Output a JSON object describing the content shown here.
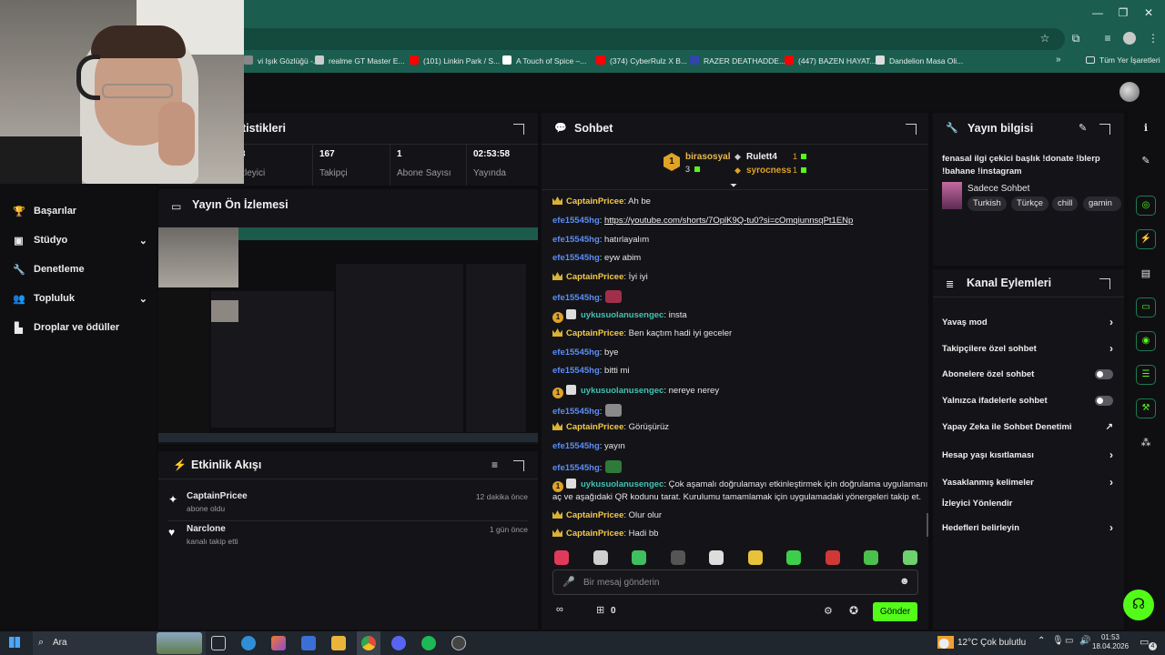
{
  "bookmarks": [
    {
      "label": "vi Işık Gözlüğü -...",
      "color": "#888888"
    },
    {
      "label": "realme GT Master E...",
      "color": "#cccccc"
    },
    {
      "label": "(101) Linkin Park / S...",
      "color": "#ff0000"
    },
    {
      "label": "A Touch of Spice –...",
      "color": "#ffffff"
    },
    {
      "label": "(374) CyberRulz X B...",
      "color": "#ff0000"
    },
    {
      "label": "RAZER DEATHADDE...",
      "color": "#3344aa"
    },
    {
      "label": "(447) BAZEN HAYAT...",
      "color": "#ff0000"
    },
    {
      "label": "Dandelion Masa Oli...",
      "color": "#dddddd"
    }
  ],
  "bookmarks_all": "Tüm Yer İşaretleri",
  "nav": {
    "items": [
      {
        "label": "Başarılar",
        "icon": "trophy-icon",
        "glyph": "🏆",
        "chevron": false
      },
      {
        "label": "Stüdyo",
        "icon": "studio-icon",
        "glyph": "▣",
        "chevron": true
      },
      {
        "label": "Denetleme",
        "icon": "wrench-icon",
        "glyph": "🔧",
        "chevron": false
      },
      {
        "label": "Topluluk",
        "icon": "community-icon",
        "glyph": "👥",
        "chevron": true
      },
      {
        "label": "Droplar ve ödüller",
        "icon": "drops-icon",
        "glyph": "▙",
        "chevron": false
      }
    ]
  },
  "stats": {
    "title": "tistikleri",
    "items": [
      {
        "value": "3",
        "label": "zleyici"
      },
      {
        "value": "167",
        "label": "Takipçi"
      },
      {
        "value": "1",
        "label": "Abone Sayısı"
      },
      {
        "value": "02:53:58",
        "label": "Yayında"
      }
    ]
  },
  "preview": {
    "title": "Yayın Ön İzlemesi"
  },
  "activity": {
    "title": "Etkinlik Akışı",
    "events": [
      {
        "user": "CaptainPricee",
        "action": "abone oldu",
        "time": "12 dakika önce",
        "icon": "sparkle-icon",
        "glyph": "✦"
      },
      {
        "user": "Narclone",
        "action": "kanalı takip etti",
        "time": "1 gün önce",
        "icon": "heart-icon",
        "glyph": "♥"
      }
    ]
  },
  "chat": {
    "title": "Sohbet",
    "top": {
      "rank_badge": "1",
      "user1": "birasosyal",
      "user1_count": "3",
      "user2": "Rulett4",
      "user2_count": "1",
      "user3": "syrocness",
      "user3_count": "1"
    },
    "messages": [
      {
        "user": "CaptainPricee",
        "kind": "cap",
        "text": ": Ah be"
      },
      {
        "user": "efe15545hg",
        "kind": "efe",
        "text": ": ",
        "link": "https://youtube.com/shorts/7OplK9Q-tu0?si=cOmqiunnsqPt1ENp"
      },
      {
        "user": "efe15545hg",
        "kind": "efe",
        "text": ": hatırlayalım"
      },
      {
        "user": "efe15545hg",
        "kind": "efe",
        "text": ": eyw abim"
      },
      {
        "user": "CaptainPricee",
        "kind": "cap",
        "text": ": İyi iyi"
      },
      {
        "user": "efe15545hg",
        "kind": "efe",
        "text": ":",
        "emote": "#a0304a"
      },
      {
        "user": "uykusuolanusengec",
        "kind": "uyku",
        "text": ": insta"
      },
      {
        "user": "CaptainPricee",
        "kind": "cap",
        "text": ": Ben kaçtım hadi iyi geceler"
      },
      {
        "user": "efe15545hg",
        "kind": "efe",
        "text": ": bye"
      },
      {
        "user": "efe15545hg",
        "kind": "efe",
        "text": ": bitti mi"
      },
      {
        "user": "uykusuolanusengec",
        "kind": "uyku",
        "text": ": nereye nerey"
      },
      {
        "user": "efe15545hg",
        "kind": "efe",
        "text": ":",
        "emote": "#8a8a8a"
      },
      {
        "user": "CaptainPricee",
        "kind": "cap",
        "text": ": Görüşürüz"
      },
      {
        "user": "efe15545hg",
        "kind": "efe",
        "text": ": yayın"
      },
      {
        "user": "efe15545hg",
        "kind": "efe",
        "text": ":",
        "emote": "#2f7a3a"
      },
      {
        "user": "uykusuolanusengec",
        "kind": "uyku",
        "text": ": Çok aşamalı doğrulamayı etkinleştirmek için doğrulama uygulamanı",
        "cont": "aç ve aşağıdaki QR kodunu tarat. Kurulumu tamamlamak için uygulamadaki yönergeleri takip et."
      },
      {
        "user": "CaptainPricee",
        "kind": "cap",
        "text": ": Olur olur"
      },
      {
        "user": "CaptainPricee",
        "kind": "cap",
        "text": ": Hadi bb"
      }
    ],
    "emotes": [
      "#e03a5a",
      "#cfcfcf",
      "#3fbf5f",
      "#555555",
      "#dddddd",
      "#e8c23a",
      "#3ccf4c",
      "#d03838",
      "#4cc04c",
      "#6fd06f"
    ],
    "input_placeholder": "Bir mesaj gönderin",
    "gift_count": "0",
    "send_label": "Gönder"
  },
  "info": {
    "title": "Yayın bilgisi",
    "stream_title": "fenasal ilgi çekici başlık !donate !blerp !bahane !instagram",
    "category": "Sadece Sohbet",
    "tags": [
      "Turkish",
      "Türkçe",
      "chill",
      "gamin"
    ]
  },
  "actions": {
    "title": "Kanal Eylemleri",
    "items": [
      {
        "label": "Yavaş mod",
        "control": "chevron"
      },
      {
        "label": "Takipçilere özel sohbet",
        "control": "chevron"
      },
      {
        "label": "Abonelere özel sohbet",
        "control": "toggle"
      },
      {
        "label": "Yalnızca ifadelerle sohbet",
        "control": "toggle"
      },
      {
        "label": "Yapay Zeka ile Sohbet Denetimi",
        "control": "external"
      },
      {
        "label": "Hesap yaşı kısıtlaması",
        "control": "chevron"
      },
      {
        "label": "Yasaklanmış kelimeler",
        "control": "chevron"
      },
      {
        "label": "İzleyici Yönlendir",
        "control": "none"
      },
      {
        "label": "Hedefleri belirleyin",
        "control": "chevron"
      }
    ]
  },
  "taskbar": {
    "search": "Ara",
    "weather": "12°C  Çok bulutlu",
    "time": "01:53",
    "date": "18.04.2026",
    "notif_count": "4"
  },
  "colors": {
    "accent": "#53fc18",
    "titlebar": "#1b5e4f"
  }
}
